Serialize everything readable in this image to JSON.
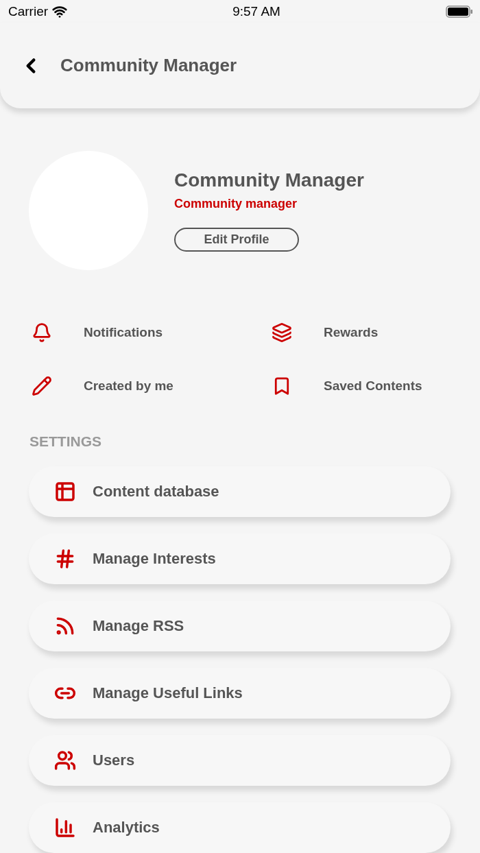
{
  "status_bar": {
    "carrier": "Carrier",
    "time": "9:57 AM"
  },
  "header": {
    "title": "Community Manager"
  },
  "profile": {
    "name": "Community Manager",
    "role": "Community manager",
    "edit_button": "Edit Profile"
  },
  "quick_links": [
    {
      "label": "Notifications"
    },
    {
      "label": "Rewards"
    },
    {
      "label": "Created by me"
    },
    {
      "label": "Saved Contents"
    }
  ],
  "settings": {
    "heading": "SETTINGS",
    "items": [
      {
        "label": "Content database"
      },
      {
        "label": "Manage Interests"
      },
      {
        "label": "Manage RSS"
      },
      {
        "label": "Manage Useful Links"
      },
      {
        "label": "Users"
      },
      {
        "label": "Analytics"
      }
    ]
  }
}
